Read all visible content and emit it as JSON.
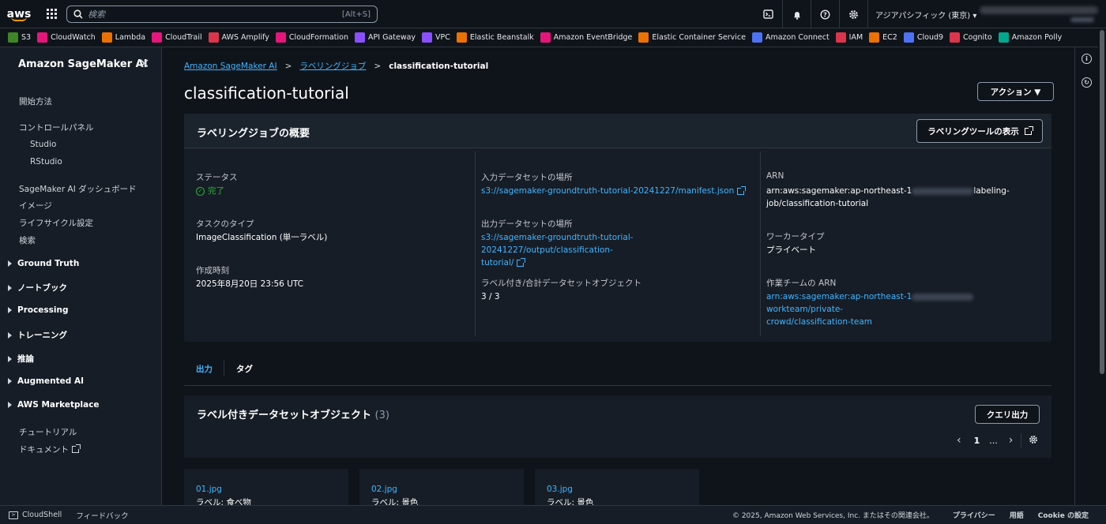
{
  "topbar": {
    "logo": "aws",
    "search_placeholder": "検索",
    "search_shortcut": "[Alt+S]",
    "region": "アジアパシフィック (東京) ▾",
    "icons": [
      "cloudshell-icon",
      "bell-icon",
      "help-icon",
      "gear-icon"
    ]
  },
  "favorites": [
    {
      "label": "S3",
      "color": "#3f8624"
    },
    {
      "label": "CloudWatch",
      "color": "#e7157b"
    },
    {
      "label": "Lambda",
      "color": "#ed7100"
    },
    {
      "label": "CloudTrail",
      "color": "#e7157b"
    },
    {
      "label": "AWS Amplify",
      "color": "#dd344c"
    },
    {
      "label": "CloudFormation",
      "color": "#e7157b"
    },
    {
      "label": "API Gateway",
      "color": "#8c4fff"
    },
    {
      "label": "VPC",
      "color": "#8c4fff"
    },
    {
      "label": "Elastic Beanstalk",
      "color": "#ed7100"
    },
    {
      "label": "Amazon EventBridge",
      "color": "#e7157b"
    },
    {
      "label": "Elastic Container Service",
      "color": "#ed7100"
    },
    {
      "label": "Amazon Connect",
      "color": "#4d72f3"
    },
    {
      "label": "IAM",
      "color": "#dd344c"
    },
    {
      "label": "EC2",
      "color": "#ed7100"
    },
    {
      "label": "Cloud9",
      "color": "#4d72f3"
    },
    {
      "label": "Cognito",
      "color": "#dd344c"
    },
    {
      "label": "Amazon Polly",
      "color": "#01a88d"
    }
  ],
  "sidebar": {
    "title": "Amazon SageMaker AI",
    "items": {
      "getting_started": "開始方法",
      "control_panel": "コントロールパネル",
      "studio": "Studio",
      "rstudio": "RStudio",
      "dashboard": "SageMaker AI ダッシュボード",
      "images": "イメージ",
      "lifecycle": "ライフサイクル設定",
      "search": "検索",
      "tutorial": "チュートリアル",
      "docs": "ドキュメント"
    },
    "groups": [
      "Ground Truth",
      "ノートブック",
      "Processing",
      "トレーニング",
      "推論",
      "Augmented AI",
      "AWS Marketplace"
    ]
  },
  "breadcrumb": {
    "root": "Amazon SageMaker AI",
    "jobs": "ラベリングジョブ",
    "current": "classification-tutorial"
  },
  "page": {
    "title": "classification-tutorial",
    "actions_button": "アクション ▼"
  },
  "summary": {
    "title": "ラベリングジョブの概要",
    "tool_button": "ラベリングツールの表示",
    "status_label": "ステータス",
    "status_value": "完了",
    "task_type_label": "タスクのタイプ",
    "task_type_value": "ImageClassification (単一ラベル)",
    "created_label": "作成時刻",
    "created_value": "2025年8月20日 23:56 UTC",
    "input_label": "入力データセットの場所",
    "input_value": "s3://sagemaker-groundtruth-tutorial-20241227/manifest.json",
    "output_label": "出力データセットの場所",
    "output_value_1": "s3://sagemaker-groundtruth-tutorial-20241227/output/classification-",
    "output_value_2": "tutorial/",
    "labeled_label": "ラベル付き/合計データセットオブジェクト",
    "labeled_value": "3 / 3",
    "arn_label": "ARN",
    "arn_value_1": "arn:aws:sagemaker:ap-northeast-1",
    "arn_value_2": "labeling-",
    "arn_value_3": "job/classification-tutorial",
    "worker_type_label": "ワーカータイプ",
    "worker_type_value": "プライベート",
    "team_arn_label": "作業チームの ARN",
    "team_arn_1": "arn:aws:sagemaker:ap-northeast-1",
    "team_arn_2": "workteam/private-",
    "team_arn_3": "crowd/classification-team"
  },
  "tabs": {
    "output": "出力",
    "tags": "タグ"
  },
  "objects": {
    "title": "ラベル付きデータセットオブジェクト",
    "count": "(3)",
    "query_button": "クエリ出力",
    "page": "1",
    "ellipsis": "...",
    "cards": [
      {
        "name": "01.jpg",
        "label": "ラベル: 食べ物"
      },
      {
        "name": "02.jpg",
        "label": "ラベル: 景色"
      },
      {
        "name": "03.jpg",
        "label": "ラベル: 景色"
      }
    ]
  },
  "footer": {
    "cloudshell": "CloudShell",
    "feedback": "フィードバック",
    "copyright": "© 2025, Amazon Web Services, Inc. またはその関連会社。",
    "privacy": "プライバシー",
    "terms": "用語",
    "cookie": "Cookie の設定"
  }
}
